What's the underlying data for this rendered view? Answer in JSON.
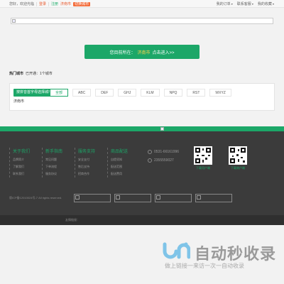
{
  "topbar": {
    "greeting": "您好，欢迎光临",
    "login": "登录",
    "register": "注册",
    "city": "济南市",
    "switch_city": "切换城市",
    "right_links": [
      "我的订单",
      "联系客服",
      "我的收藏"
    ]
  },
  "cta": {
    "prefix": "您目前所在：",
    "city": "济南市",
    "action": "点击进入>>"
  },
  "hot_cities": {
    "label": "热门城市",
    "opened": "已开通：1个城市"
  },
  "selector": {
    "label": "按拼音首字母选择城市：",
    "letters": [
      "全部",
      "ABC",
      "DEF",
      "GHJ",
      "KLM",
      "NPQ",
      "RST",
      "WXYZ"
    ],
    "cities": [
      "济南市"
    ]
  },
  "footer": {
    "columns": [
      {
        "title": "关于我们",
        "links": [
          "品牌简介",
          "了解我们",
          "联系我们"
        ]
      },
      {
        "title": "新手指南",
        "links": [
          "常见问题",
          "下单流程",
          "服务协议"
        ]
      },
      {
        "title": "服务支持",
        "links": [
          "安全支付",
          "售后支持",
          "招商合作"
        ]
      },
      {
        "title": "商品配送",
        "links": [
          "自提须知",
          "配送范围",
          "配送费用"
        ]
      }
    ],
    "contact": {
      "phone": "0531-66161996",
      "qq": "2355559027"
    },
    "qr_codes": [
      {
        "label": "下载用户端"
      },
      {
        "label": "下载商户端"
      }
    ],
    "copyright": "版ICP备12010024号-7 All rights reserved."
  },
  "bottom": {
    "links_label": "友情链接："
  },
  "watermark": {
    "title": "自动秒收录",
    "subtitle": "做上链接一来访一次一自动收录"
  }
}
